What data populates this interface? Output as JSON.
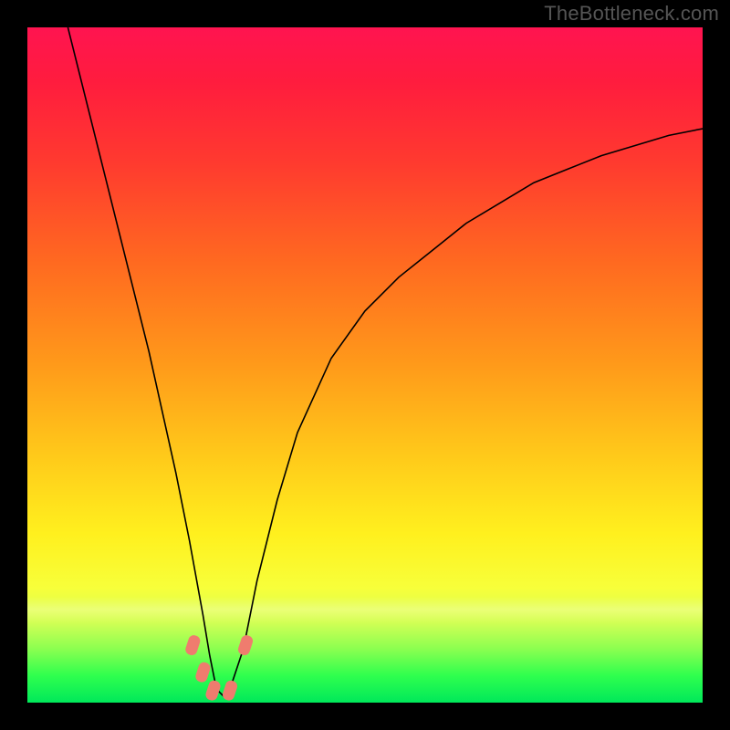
{
  "watermark": "TheBottleneck.com",
  "chart_data": {
    "type": "line",
    "title": "",
    "xlabel": "",
    "ylabel": "",
    "xlim": [
      0,
      100
    ],
    "ylim": [
      0,
      100
    ],
    "note": "Axes are implicit (no tick labels shown). Values are estimated from visual proportions on a 0–100 scale. The curve is a V-shaped bottleneck plot with its minimum near x≈28, y≈1.",
    "series": [
      {
        "name": "bottleneck-curve",
        "x": [
          6,
          9,
          12,
          15,
          18,
          20,
          22,
          24,
          26,
          27,
          28,
          29,
          30,
          32,
          34,
          37,
          40,
          45,
          50,
          55,
          60,
          65,
          70,
          75,
          80,
          85,
          90,
          95,
          100
        ],
        "y": [
          100,
          88,
          76,
          64,
          52,
          43,
          34,
          24,
          13,
          7,
          2,
          1,
          2,
          8,
          18,
          30,
          40,
          51,
          58,
          63,
          67,
          71,
          74,
          77,
          79,
          81,
          82.5,
          84,
          85
        ]
      }
    ],
    "markers": [
      {
        "name": "marker-left-upper",
        "x": 24.5,
        "y": 8.5
      },
      {
        "name": "marker-left-lower",
        "x": 26.0,
        "y": 4.5
      },
      {
        "name": "marker-min-left",
        "x": 27.5,
        "y": 1.8
      },
      {
        "name": "marker-min-right",
        "x": 30.0,
        "y": 1.8
      },
      {
        "name": "marker-right-upper",
        "x": 32.3,
        "y": 8.5
      }
    ],
    "background_gradient_stops": [
      {
        "pos": 0.0,
        "color": "#ff1450"
      },
      {
        "pos": 0.2,
        "color": "#ff3a2f"
      },
      {
        "pos": 0.5,
        "color": "#ff9a1a"
      },
      {
        "pos": 0.75,
        "color": "#fff01e"
      },
      {
        "pos": 0.92,
        "color": "#8cff50"
      },
      {
        "pos": 1.0,
        "color": "#00e85a"
      }
    ]
  }
}
